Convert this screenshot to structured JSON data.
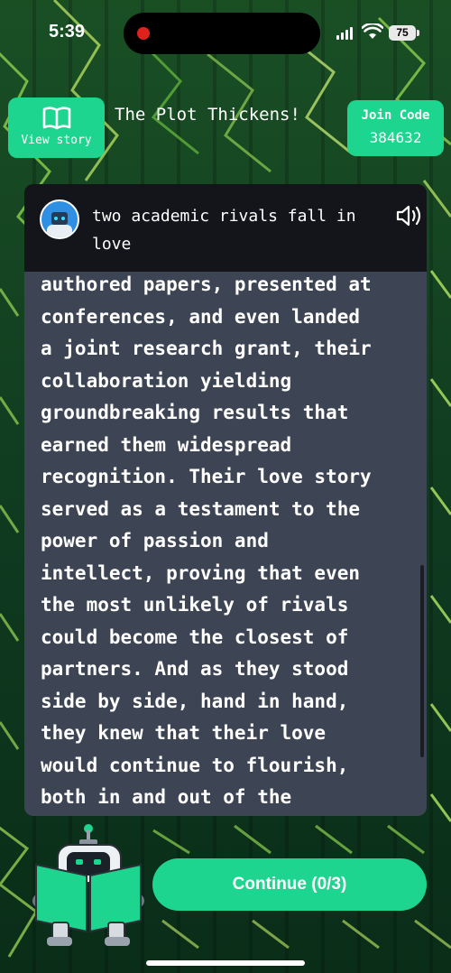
{
  "status_bar": {
    "time": "5:39",
    "battery": "75"
  },
  "header": {
    "view_story_label": "View story",
    "title": "The Plot Thickens!",
    "join_code_label": "Join Code",
    "join_code_value": "384632"
  },
  "story": {
    "prompt": "two academic rivals fall in love",
    "text_lines": [
      "authored papers, presented at",
      "conferences, and even landed",
      "a joint research grant, their",
      "collaboration yielding",
      "groundbreaking results that",
      "earned them widespread",
      "recognition. Their love story",
      "served as a testament to the",
      "power of passion and",
      "intellect, proving that even",
      "the most unlikely of rivals",
      "could become the closest of",
      "partners. And as they stood",
      "side by side, hand in hand,",
      "they knew that their love",
      "would continue to flourish,",
      "both in and out of the"
    ]
  },
  "continue_label": "Continue (0/3)",
  "colors": {
    "accent": "#1ed58f",
    "card": "#3d4454",
    "card_header": "#13151a"
  },
  "icons": [
    "book-open-icon",
    "speaker-icon",
    "robot-avatar",
    "signal-icon",
    "wifi-icon",
    "battery-icon"
  ]
}
